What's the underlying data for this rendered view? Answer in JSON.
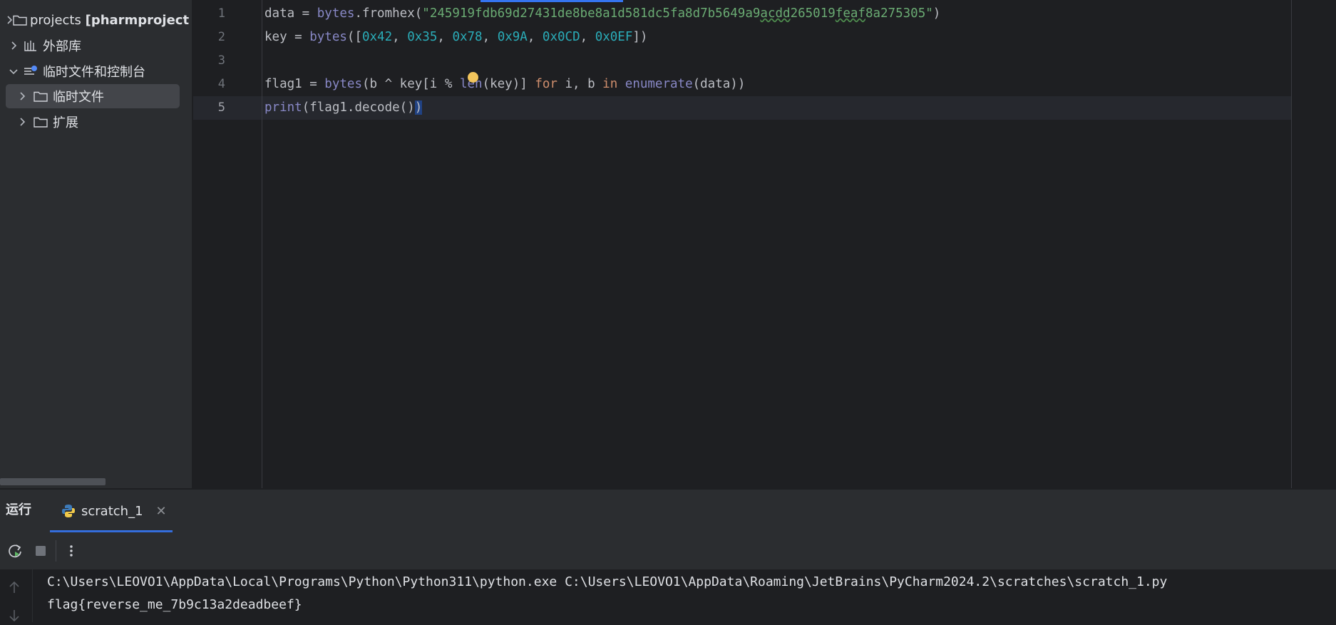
{
  "project_tree": {
    "items": [
      {
        "label": "projects",
        "bold_suffix": "[pharmproject",
        "expanded": false
      },
      {
        "label": "外部库",
        "expanded": false
      },
      {
        "label": "临时文件和控制台",
        "expanded": true
      },
      {
        "label": "临时文件",
        "expanded": false,
        "selected": true
      },
      {
        "label": "扩展",
        "expanded": false
      }
    ]
  },
  "editor": {
    "line_numbers": [
      "1",
      "2",
      "3",
      "4",
      "5"
    ],
    "current_line": "5",
    "lines": [
      [
        {
          "t": "data = ",
          "c": "plain"
        },
        {
          "t": "bytes",
          "c": "fn"
        },
        {
          "t": ".fromhex(",
          "c": "plain"
        },
        {
          "t": "\"245919fdb69d27431de8be8a1d581dc5fa8d7b5649a9",
          "c": "str"
        },
        {
          "t": "acdd",
          "c": "str-warn"
        },
        {
          "t": "265019",
          "c": "str"
        },
        {
          "t": "feaf",
          "c": "str-warn"
        },
        {
          "t": "8a275305\"",
          "c": "str"
        },
        {
          "t": ")",
          "c": "plain"
        }
      ],
      [
        {
          "t": "key = ",
          "c": "plain"
        },
        {
          "t": "bytes",
          "c": "fn"
        },
        {
          "t": "([",
          "c": "plain"
        },
        {
          "t": "0x42",
          "c": "num"
        },
        {
          "t": ", ",
          "c": "plain"
        },
        {
          "t": "0x35",
          "c": "num"
        },
        {
          "t": ", ",
          "c": "plain"
        },
        {
          "t": "0x78",
          "c": "num"
        },
        {
          "t": ", ",
          "c": "plain"
        },
        {
          "t": "0x9A",
          "c": "num"
        },
        {
          "t": ", ",
          "c": "plain"
        },
        {
          "t": "0x0CD",
          "c": "num"
        },
        {
          "t": ", ",
          "c": "plain"
        },
        {
          "t": "0x0EF",
          "c": "num"
        },
        {
          "t": "])",
          "c": "plain"
        }
      ],
      [],
      [
        {
          "t": "flag1 = ",
          "c": "plain"
        },
        {
          "t": "bytes",
          "c": "fn"
        },
        {
          "t": "(b ^ key[i % ",
          "c": "plain"
        },
        {
          "t": "len",
          "c": "fn"
        },
        {
          "t": "(key)] ",
          "c": "plain"
        },
        {
          "t": "for",
          "c": "kw"
        },
        {
          "t": " i, b ",
          "c": "plain"
        },
        {
          "t": "in",
          "c": "kw"
        },
        {
          "t": " ",
          "c": "plain"
        },
        {
          "t": "enumerate",
          "c": "fn"
        },
        {
          "t": "(data))",
          "c": "plain"
        }
      ],
      [
        {
          "t": "print",
          "c": "fn"
        },
        {
          "t": "(flag1.decode()",
          "c": "plain"
        },
        {
          "t": ")",
          "c": "caret"
        }
      ]
    ]
  },
  "run_panel": {
    "title": "运行",
    "tab_label": "scratch_1",
    "console_lines": [
      "C:\\Users\\LEOVO1\\AppData\\Local\\Programs\\Python\\Python311\\python.exe C:\\Users\\LEOVO1\\AppData\\Roaming\\JetBrains\\PyCharm2024.2\\scratches\\scratch_1.py",
      "flag{reverse_me_7b9c13a2deadbeef}"
    ]
  },
  "colors": {
    "accent": "#3574f0",
    "background": "#1e1f22",
    "panel": "#2b2d30"
  }
}
